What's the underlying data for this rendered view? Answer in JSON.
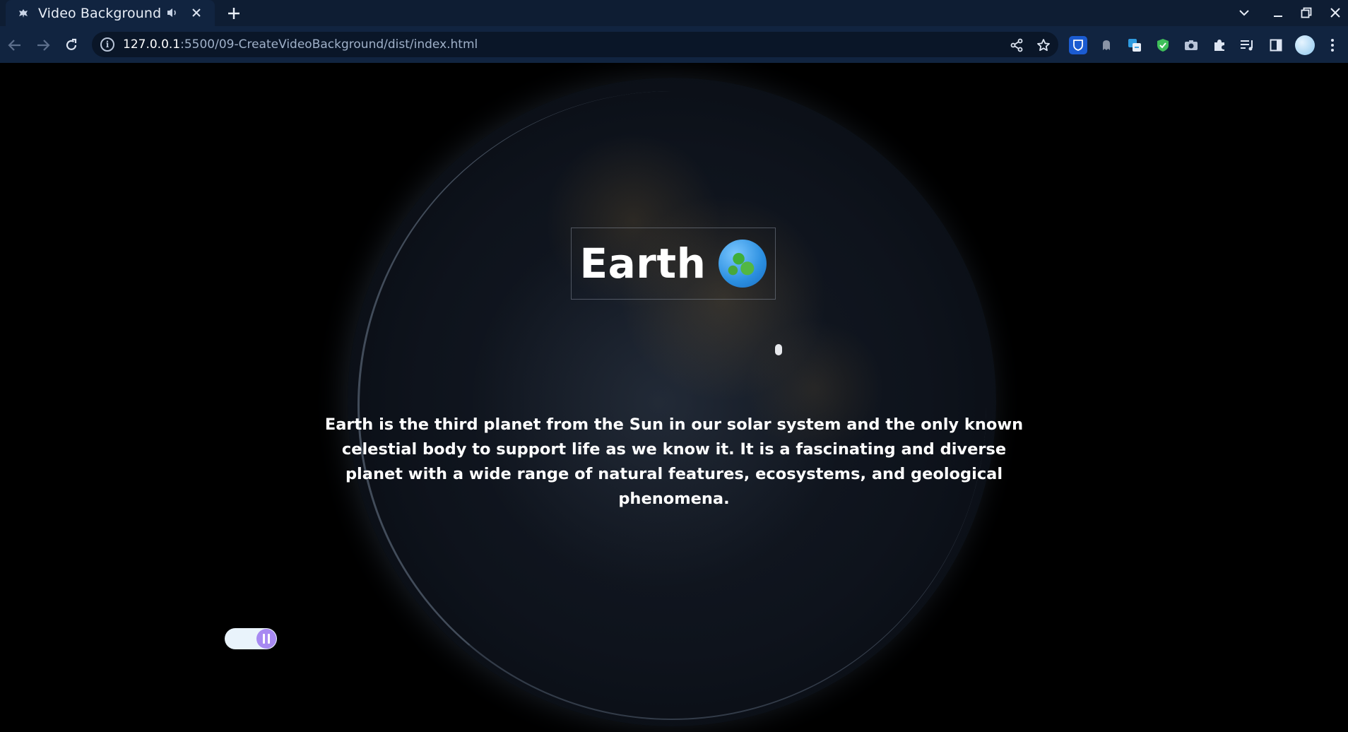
{
  "browser": {
    "tab": {
      "title": "Video Background",
      "favicon": "bat-icon",
      "audio_icon": "speaker-icon",
      "close_icon": "close-icon"
    },
    "new_tab_icon": "plus-icon",
    "window_controls": [
      "chevron-down-icon",
      "minimize-icon",
      "restore-icon",
      "close-icon"
    ],
    "url": {
      "host": "127.0.0.1",
      "path": ":5500/09-CreateVideoBackground/dist/index.html"
    },
    "nav": [
      "back-icon",
      "forward-icon",
      "reload-icon"
    ],
    "omnibox_actions": [
      "share-icon",
      "bookmark-star-icon"
    ],
    "extensions": [
      "bitwarden-icon",
      "ghost-icon",
      "translate-icon",
      "shield-icon",
      "camera-icon",
      "puzzle-icon",
      "media-list-icon",
      "side-panel-icon",
      "profile-avatar"
    ]
  },
  "page": {
    "heading": "Earth",
    "heading_emoji": "globe-europe-africa-icon",
    "description": "Earth is the third planet from the Sun in our solar system and the only known celestial body to support life as we know it. It is a fascinating and diverse planet with a wide range of natural features, ecosystems, and geological phenomena.",
    "video_toggle": {
      "state": "playing",
      "icon": "pause-icon",
      "colors": {
        "track": "#e9f3fb",
        "knob": "#a789f2"
      }
    }
  },
  "colors": {
    "chrome_bg": "#0e1d33",
    "toolbar_bg": "#112440",
    "omnibox_bg": "#0a1628",
    "page_bg": "#000000"
  }
}
